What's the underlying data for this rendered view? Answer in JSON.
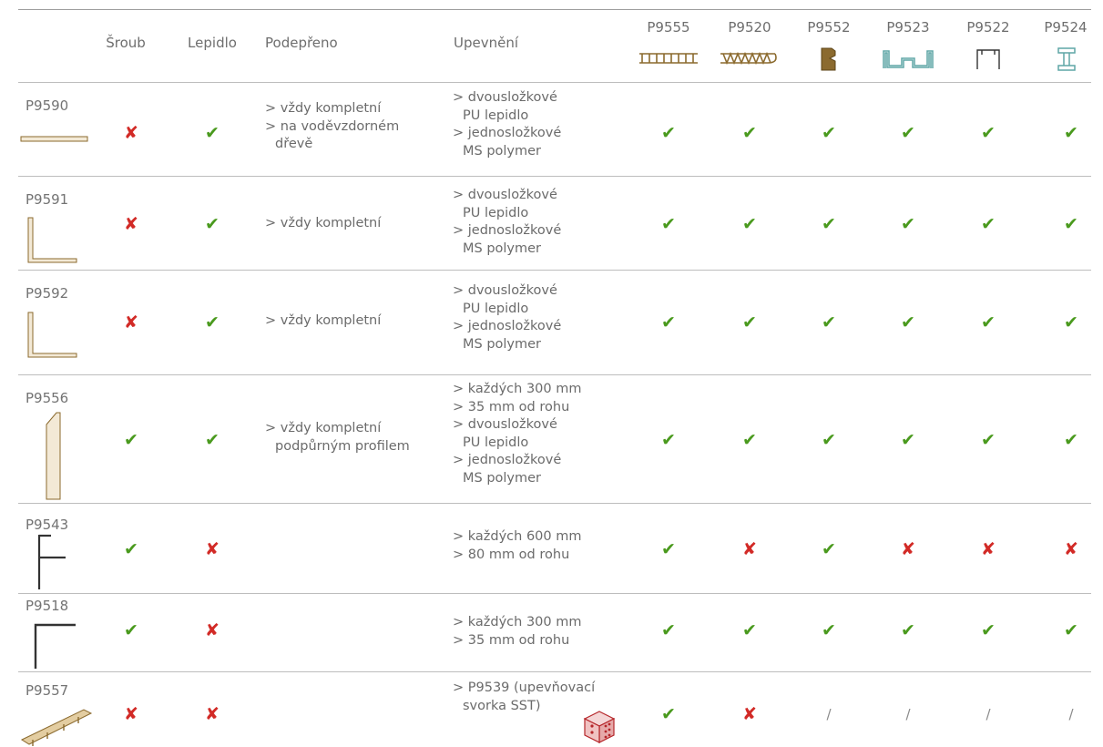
{
  "header": {
    "sroub": "Šroub",
    "lepidlo": "Lepidlo",
    "podepreno": "Podepřeno",
    "upevneni": "Upevnění",
    "profiles": [
      {
        "code": "P9555",
        "icon": "profile-comb-icon"
      },
      {
        "code": "P9520",
        "icon": "profile-zigzag-icon"
      },
      {
        "code": "P9552",
        "icon": "profile-notch-icon"
      },
      {
        "code": "P9523",
        "icon": "profile-channel-icon"
      },
      {
        "code": "P9522",
        "icon": "profile-bracket-icon"
      },
      {
        "code": "P9524",
        "icon": "profile-ibeam-icon"
      }
    ]
  },
  "colors": {
    "check": "#4a9a1e",
    "cross": "#d22a26",
    "line": "#bdbdbd",
    "profile": "#8b6a2e"
  },
  "symbols": {
    "check": "✔",
    "cross": "✘",
    "na": "/"
  },
  "rows": [
    {
      "code": "P9590",
      "icon": "flat-strip-icon",
      "sroub": "cross",
      "lepidlo": "check",
      "podepreno": [
        "> vždy kompletní",
        "> na voděvzdorném",
        "dřevě"
      ],
      "upevneni": [
        "> dvousložkové",
        "PU lepidlo",
        "> jednosložkové",
        "MS polymer"
      ],
      "compat": [
        "check",
        "check",
        "check",
        "check",
        "check",
        "check"
      ]
    },
    {
      "code": "P9591",
      "icon": "angle-profile-icon",
      "sroub": "cross",
      "lepidlo": "check",
      "podepreno": [
        "> vždy kompletní"
      ],
      "upevneni": [
        "> dvousložkové",
        "PU lepidlo",
        "> jednosložkové",
        "MS polymer"
      ],
      "compat": [
        "check",
        "check",
        "check",
        "check",
        "check",
        "check"
      ]
    },
    {
      "code": "P9592",
      "icon": "angle-profile-icon",
      "sroub": "cross",
      "lepidlo": "check",
      "podepreno": [
        "> vždy kompletní"
      ],
      "upevneni": [
        "> dvousložkové",
        "PU lepidlo",
        "> jednosložkové",
        "MS polymer"
      ],
      "compat": [
        "check",
        "check",
        "check",
        "check",
        "check",
        "check"
      ]
    },
    {
      "code": "P9556",
      "icon": "vertical-board-icon",
      "sroub": "check",
      "lepidlo": "check",
      "podepreno": [
        "> vždy kompletní",
        "podpůrným profilem"
      ],
      "upevneni": [
        "> každých 300 mm",
        "> 35 mm od rohu",
        "> dvousložkové",
        "PU lepidlo",
        "> jednosložkové",
        "MS polymer"
      ],
      "compat": [
        "check",
        "check",
        "check",
        "check",
        "check",
        "check"
      ]
    },
    {
      "code": "P9543",
      "icon": "f-profile-icon",
      "sroub": "check",
      "lepidlo": "cross",
      "podepreno": [],
      "upevneni": [
        "> každých 600 mm",
        "> 80 mm od rohu"
      ],
      "compat": [
        "check",
        "cross",
        "check",
        "cross",
        "cross",
        "cross"
      ]
    },
    {
      "code": "P9518",
      "icon": "corner-profile-icon",
      "sroub": "check",
      "lepidlo": "cross",
      "podepreno": [],
      "upevneni": [
        "> každých 300 mm",
        "> 35 mm od rohu"
      ],
      "compat": [
        "check",
        "check",
        "check",
        "check",
        "check",
        "check"
      ]
    },
    {
      "code": "P9557",
      "icon": "rail-profile-icon",
      "sroub": "cross",
      "lepidlo": "cross",
      "podepreno": [],
      "upevneni": [
        "> P9539 (upevňovací",
        "svorka SST)"
      ],
      "clip_icon": "clip-bracket-icon",
      "compat": [
        "check",
        "cross",
        "na",
        "na",
        "na",
        "na"
      ]
    }
  ]
}
